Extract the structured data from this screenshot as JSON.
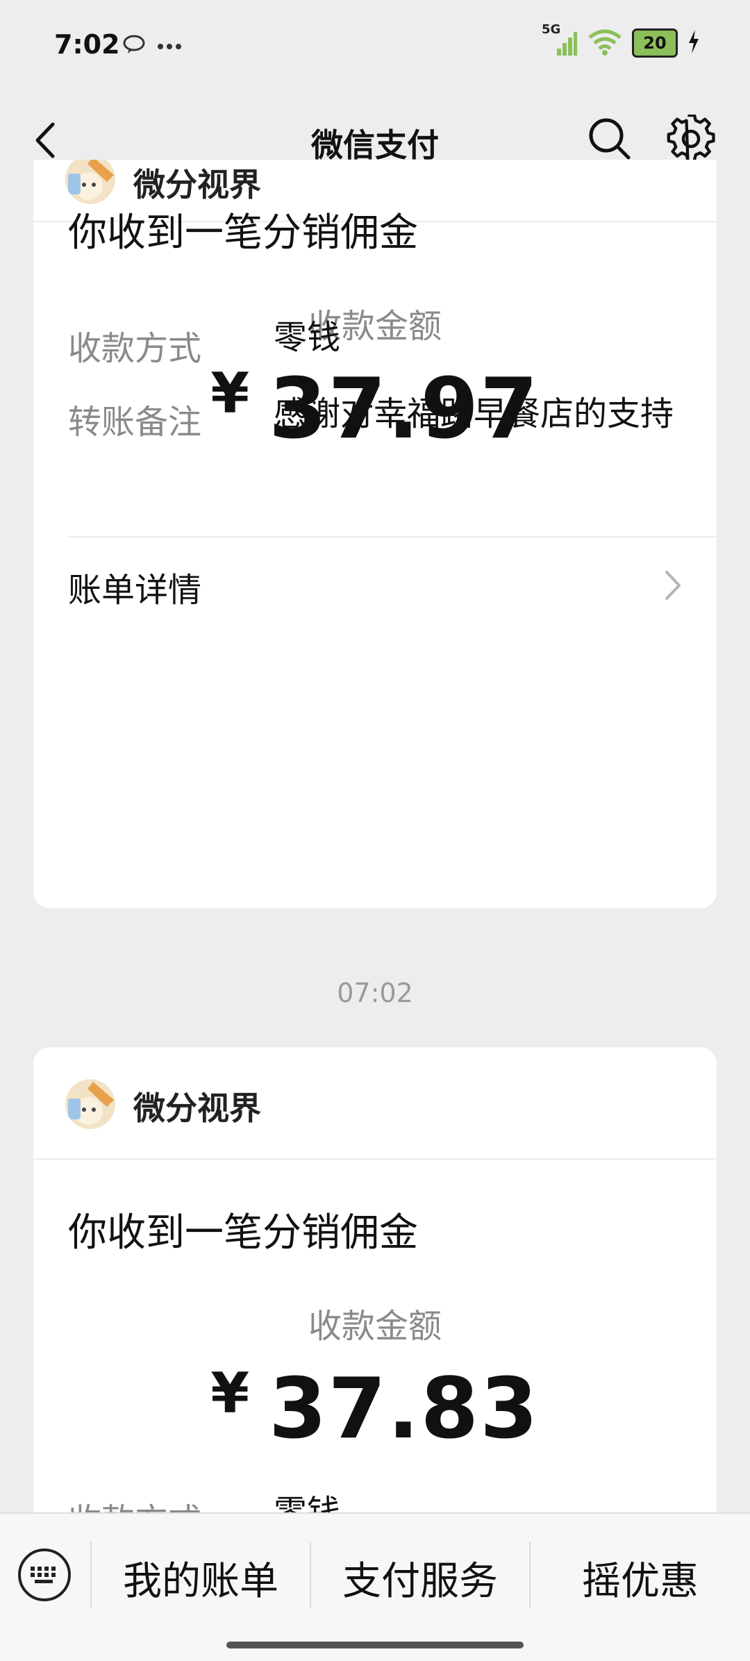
{
  "status_bar": {
    "time": "7:02",
    "network": "5G",
    "battery": "20"
  },
  "nav": {
    "title": "微信支付"
  },
  "cards": [
    {
      "merchant": "微分视界",
      "title": "你收到一笔分销佣金",
      "amount_label": "收款金额",
      "currency": "¥",
      "amount": "37.97",
      "method_label": "收款方式",
      "method_value": "零钱",
      "remark_label": "转账备注",
      "remark_value": "感谢对幸福路早餐店的支持",
      "bill_link": "账单详情"
    },
    {
      "merchant": "微分视界",
      "title": "你收到一笔分销佣金",
      "amount_label": "收款金额",
      "currency": "¥",
      "amount": "37.83",
      "method_label": "收款方式",
      "method_value": "零钱"
    }
  ],
  "timestamp": "07:02",
  "toolbar": {
    "my_bills": "我的账单",
    "pay_services": "支付服务",
    "shake_deals": "摇优惠"
  },
  "colors": {
    "background": "#ededed",
    "card": "#ffffff",
    "muted_text": "#8a8a8a"
  }
}
